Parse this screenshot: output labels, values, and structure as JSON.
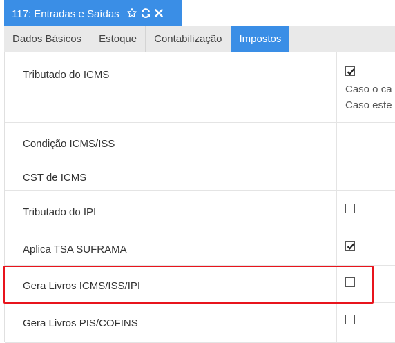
{
  "window": {
    "title": "117: Entradas e Saídas",
    "icons": [
      "star-outline-icon",
      "refresh-icon",
      "close-icon"
    ],
    "accent": "#3a8ee6"
  },
  "tabs": [
    {
      "label": "Dados Básicos",
      "active": false
    },
    {
      "label": "Estoque",
      "active": false
    },
    {
      "label": "Contabilização",
      "active": false
    },
    {
      "label": "Impostos",
      "active": true
    }
  ],
  "rows": [
    {
      "label": "Tributado do ICMS",
      "checked": true,
      "notes": [
        "Caso o ca",
        "Caso este"
      ]
    },
    {
      "label": "Condição ICMS/ISS"
    },
    {
      "label": "CST de ICMS"
    },
    {
      "label": "Tributado do IPI",
      "checked": false
    },
    {
      "label": "Aplica TSA SUFRAMA",
      "checked": true
    },
    {
      "label": "Gera Livros ICMS/ISS/IPI",
      "checked": false,
      "highlighted": true
    },
    {
      "label": "Gera Livros PIS/COFINS",
      "checked": false
    }
  ],
  "highlight_color": "#e8141c"
}
